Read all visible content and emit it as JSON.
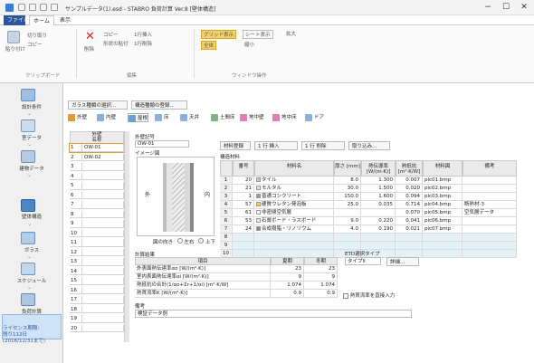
{
  "window": {
    "title": "サンプルデータ(1).esd - STABRO 負荷計算 Ver.8 [壁体構造]",
    "controls": {
      "minimize": "−",
      "maximize": "☐",
      "close": "✕"
    }
  },
  "menu_tabs": [
    "ファイル",
    "ホーム",
    "表示"
  ],
  "ribbon": {
    "clipboard": {
      "paste": "貼り付け",
      "cut": "切り取り",
      "copy": "コピー",
      "label": "クリップボード"
    },
    "edit": {
      "delete": "削除",
      "copy": "コピー",
      "paste_format": "形状の貼付",
      "insert_row": "1行挿入",
      "delete_row": "1行削除",
      "label": "編集"
    },
    "display": {
      "grid_display": "グリッド表示",
      "sheet_display": "シート表示",
      "zoom": "拡大",
      "fit": "全体",
      "shrink": "縮小",
      "label": "ウィンドウ操作"
    }
  },
  "nav": [
    {
      "label": "設計条件"
    },
    {
      "label": "室データ"
    },
    {
      "label": "建物データ"
    },
    {
      "label": "壁体構造",
      "active": true
    },
    {
      "label": "ガラス"
    },
    {
      "label": "スケジュール"
    },
    {
      "label": "負荷計算"
    }
  ],
  "nav_footer": [
    "ライセンス期限:",
    "残り112日",
    "(2016/12/31まで)"
  ],
  "toolbar": {
    "select_button": "ガラス種類の選択...",
    "register_button": "構造種類の登録..."
  },
  "section_tabs": [
    "外壁",
    "内壁",
    "屋根",
    "床",
    "天井",
    "土間床",
    "地中壁",
    "地中床",
    "ドア"
  ],
  "list": {
    "header": "外壁",
    "header_sub": "名称",
    "rows": [
      {
        "no": "1",
        "name": "OW-01"
      },
      {
        "no": "2",
        "name": "OW-02"
      },
      {
        "no": "3",
        "name": ""
      },
      {
        "no": "4",
        "name": ""
      },
      {
        "no": "5",
        "name": ""
      },
      {
        "no": "6",
        "name": ""
      },
      {
        "no": "7",
        "name": ""
      },
      {
        "no": "8",
        "name": ""
      },
      {
        "no": "9",
        "name": ""
      },
      {
        "no": "10",
        "name": ""
      },
      {
        "no": "11",
        "name": ""
      },
      {
        "no": "12",
        "name": ""
      },
      {
        "no": "13",
        "name": ""
      },
      {
        "no": "14",
        "name": ""
      },
      {
        "no": "15",
        "name": ""
      },
      {
        "no": "16",
        "name": ""
      },
      {
        "no": "17",
        "name": ""
      },
      {
        "no": "18",
        "name": ""
      },
      {
        "no": "19",
        "name": ""
      },
      {
        "no": "20",
        "name": ""
      }
    ]
  },
  "detail": {
    "code_label": "外壁記号",
    "code_value": "OW-01",
    "image_label": "イメージ図",
    "outside": "外",
    "inside": "内",
    "sketch_label": "図の向き",
    "sketch_options": [
      "左右",
      "上下"
    ],
    "structure_label": "構造材料",
    "buttons": {
      "template": "材料登録",
      "insert": "1 行 挿入",
      "delete": "1 行 削除",
      "import": "取り込み..."
    },
    "columns": [
      "番号",
      "材料名",
      "厚さ [mm]",
      "熱伝導率 [W/(m·K)]",
      "熱抵抗 [m²·K/W]",
      "材料図",
      "備考"
    ],
    "rows": [
      {
        "idx": "1",
        "num": "20",
        "name": "タイル",
        "thick": "8.0",
        "cond": "1.300",
        "res": "0.007",
        "img": "pic01.bmp",
        "note": ""
      },
      {
        "idx": "2",
        "num": "21",
        "name": "モルタル",
        "thick": "30.0",
        "cond": "1.500",
        "res": "0.020",
        "img": "pic02.bmp",
        "note": ""
      },
      {
        "idx": "3",
        "num": "1",
        "name": "普通コンクリート",
        "thick": "150.0",
        "cond": "1.600",
        "res": "0.094",
        "img": "pic03.bmp",
        "note": ""
      },
      {
        "idx": "4",
        "num": "57",
        "name": "硬質ウレタン発泡板",
        "thick": "25.0",
        "cond": "0.035",
        "res": "0.714",
        "img": "pic04.bmp",
        "note": "断熱材-3"
      },
      {
        "idx": "5",
        "num": "61",
        "name": "非密閉空気層",
        "thick": "",
        "cond": "",
        "res": "0.070",
        "img": "pic05.bmp",
        "note": "空気層データ"
      },
      {
        "idx": "6",
        "num": "53",
        "name": "石膏ボード・ラスボード",
        "thick": "9.0",
        "cond": "0.220",
        "res": "0.041",
        "img": "pic06.bmp",
        "note": ""
      },
      {
        "idx": "7",
        "num": "24",
        "name": "合成樹脂・リノリウム",
        "thick": "4.0",
        "cond": "0.190",
        "res": "0.021",
        "img": "pic07.bmp",
        "note": ""
      },
      {
        "idx": "8",
        "num": "",
        "name": "",
        "thick": "",
        "cond": "",
        "res": "",
        "img": "",
        "note": ""
      },
      {
        "idx": "9",
        "num": "",
        "name": "",
        "thick": "",
        "cond": "",
        "res": "",
        "img": "",
        "note": ""
      },
      {
        "idx": "10",
        "num": "",
        "name": "",
        "thick": "",
        "cond": "",
        "res": "",
        "img": "",
        "note": ""
      }
    ],
    "summary_label": "計算結果",
    "summary_cols": [
      "項目",
      "夏期",
      "冬期"
    ],
    "summary": [
      {
        "label": "外表面熱伝達率αo [W/(m²·K)]",
        "summer": "23",
        "winter": "23"
      },
      {
        "label": "室内表面熱伝達率αi [W/(m²·K)]",
        "summer": "9",
        "winter": "9"
      },
      {
        "label": "熱抵抗の合計(1/αo+Σr+1/αi) [m²·K/W]",
        "summer": "1.074",
        "winter": "1.074"
      },
      {
        "label": "熱貫流率K [W/(m²·K)]",
        "summer": "0.9",
        "winter": "0.9"
      }
    ],
    "wall_type_label": "ETD選択タイプ",
    "wall_type_value": "タイプII",
    "detail_button": "詳細...",
    "manual_check": "熱貫流率を直接入力",
    "note_label": "備考",
    "note_value": "検証データ例"
  }
}
